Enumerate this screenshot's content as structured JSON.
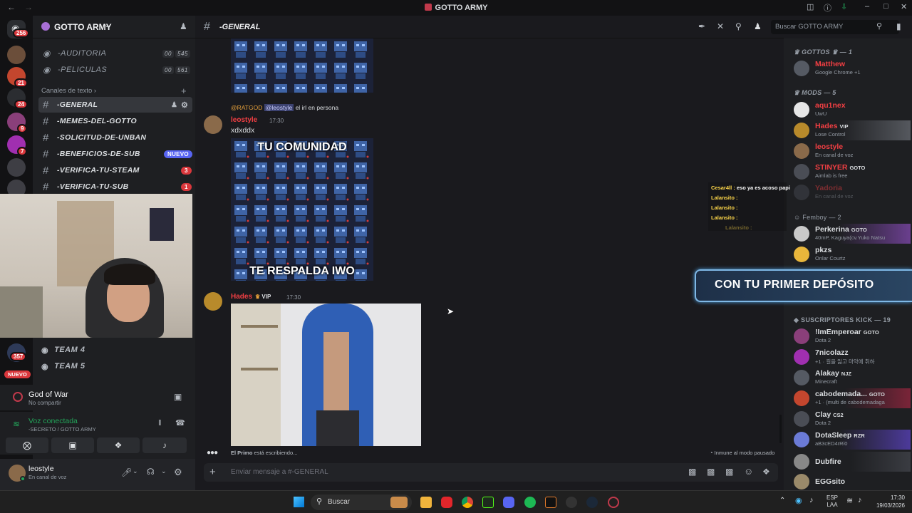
{
  "window": {
    "title": "GOTTO ARMY"
  },
  "servers": {
    "badges": [
      "256",
      "21",
      "24",
      "9",
      "7",
      "357"
    ],
    "new_label": "NUEVO"
  },
  "guild": {
    "name": "GOTTO ARMY",
    "voice_channels": [
      {
        "name": "-AUDITORIA",
        "count_a": "00",
        "count_b": "545"
      },
      {
        "name": "-PELICULAS",
        "count_a": "00",
        "count_b": "561"
      }
    ],
    "text_category": "Canales de texto",
    "text_channels": [
      {
        "name": "-GENERAL"
      },
      {
        "name": "-MEMES-DEL-GOTTO"
      },
      {
        "name": "-SOLICITUD-DE-UNBAN"
      },
      {
        "name": "-BENEFICIOS-DE-SUB",
        "badge": "NUEVO"
      },
      {
        "name": "-VERIFICA-TU-STEAM",
        "badge": "3"
      },
      {
        "name": "-VERIFICA-TU-SUB",
        "badge": "1"
      }
    ],
    "teams": [
      "TEAM 4",
      "TEAM 5"
    ]
  },
  "activity": {
    "game": "God of War",
    "status": "No compartir"
  },
  "voice": {
    "status": "Voz conectada",
    "location": "-SECRETO / GOTTO ARMY"
  },
  "user": {
    "name": "leostyle",
    "status": "En canal de voz"
  },
  "chat": {
    "channel": "-GENERAL",
    "search_placeholder": "Buscar GOTTO ARMY",
    "reply": {
      "author": "@RATGOD",
      "mention": "@leostyle",
      "text": "el irl en persona"
    },
    "msg1": {
      "author": "leostyle",
      "time": "17:30",
      "text": "xdxddx",
      "meme_top": "TU COMUNIDAD",
      "meme_bottom": "TE RESPALDA IWO"
    },
    "msg2": {
      "author": "Hades",
      "tag": "VIP",
      "time": "17:30"
    },
    "typing": "El Primo",
    "typing_suffix": "está escribiendo...",
    "slowmode": "Inmune al modo pausado",
    "input_placeholder": "Enviar mensaje a #-GENERAL"
  },
  "members": {
    "groups": [
      {
        "title": "GOTTOS",
        "count": "— 1"
      },
      {
        "title": "MODS",
        "count": "— 5"
      },
      {
        "title": "Femboy",
        "count": "— 2"
      },
      {
        "title": "SUSCRIPTORES KICK",
        "count": "— 19"
      }
    ],
    "list": [
      {
        "name": "Matthew",
        "sub": "Google Chrome +1",
        "color": "#f23f43"
      },
      {
        "name": "aqu1nex",
        "sub": "UwU",
        "color": "#f23f43"
      },
      {
        "name": "Hades",
        "tag": "VIP",
        "sub": "Lose Control",
        "color": "#f23f43"
      },
      {
        "name": "leostyle",
        "sub": "En canal de voz",
        "color": "#f23f43"
      },
      {
        "name": "STINYER",
        "tag": "GOTO",
        "sub": "Aimlab is free",
        "color": "#f23f43"
      },
      {
        "name": "Yadoria",
        "sub": "En canal de voz",
        "color": "#f23f43"
      },
      {
        "name": "Perkerina",
        "tag": "GOTO",
        "sub": "40mP, Kaguya(cv.Yuko Natsu",
        "color": "#dbdee1"
      },
      {
        "name": "pkzs",
        "sub": "Onlar Courtz",
        "color": "#dbdee1"
      },
      {
        "name": "!ImEmperoar",
        "tag": "GOTO",
        "sub": "Dota 2",
        "color": "#dbdee1"
      },
      {
        "name": "7nicolazz",
        "sub": "+1 · 길을 잃고 마악에 취하",
        "color": "#dbdee1"
      },
      {
        "name": "Alakay",
        "tag": "NJZ",
        "sub": "Minecraft",
        "color": "#dbdee1"
      },
      {
        "name": "cabodemada...",
        "tag": "GOTO",
        "sub": "+1 · (multi de cabodemadaga",
        "color": "#dbdee1"
      },
      {
        "name": "Clay",
        "tag": "CS2",
        "sub": "Dota 2",
        "color": "#dbdee1"
      },
      {
        "name": "DotaSleep",
        "tag": "RZR",
        "sub": "aB3cED4rRi0",
        "color": "#dbdee1"
      },
      {
        "name": "Dubfire",
        "color": "#dbdee1"
      },
      {
        "name": "EGGsito",
        "color": "#dbdee1"
      }
    ]
  },
  "overlay": {
    "banner": "CON TU PRIMER DEPÓSITO",
    "chat": [
      {
        "user": "Cesar4ll :",
        "text": "eso ya es acoso papi"
      },
      {
        "user": "Lalansito :"
      },
      {
        "user": "Lalansito :"
      },
      {
        "user": "Lalansito :"
      },
      {
        "user": "Lalansito :"
      }
    ]
  },
  "taskbar": {
    "search": "Buscar",
    "lang_a": "ESP",
    "lang_b": "LAA",
    "time": "17:30",
    "date": "19/03/2026"
  },
  "colors": {
    "accent": "#5865f2",
    "danger": "#da373c",
    "online": "#23a55a",
    "bg": "#1a1a1e"
  }
}
